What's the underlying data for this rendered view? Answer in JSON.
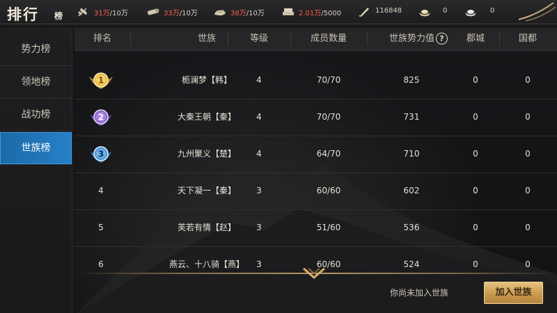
{
  "header": {
    "title_main": "排行",
    "title_sub": "榜",
    "resources": [
      {
        "icon": "grain-icon",
        "current": "31万",
        "max": "/10万",
        "current_color": "#ff5a4a"
      },
      {
        "icon": "wood-icon",
        "current": "33万",
        "max": "/10万",
        "current_color": "#ff5a4a"
      },
      {
        "icon": "stone-icon",
        "current": "38万",
        "max": "/10万",
        "current_color": "#ff5a4a"
      },
      {
        "icon": "iron-icon",
        "current": "2.01万",
        "max": "/5000",
        "current_color": "#ff5a4a"
      },
      {
        "icon": "decree-icon",
        "current": "116848",
        "max": ""
      },
      {
        "icon": "gold-ingot-icon",
        "current": "0",
        "max": ""
      },
      {
        "icon": "silver-ingot-icon",
        "current": "0",
        "max": ""
      }
    ]
  },
  "sidebar": {
    "items": [
      {
        "label": "势力榜",
        "active": false
      },
      {
        "label": "领地榜",
        "active": false
      },
      {
        "label": "战功榜",
        "active": false
      },
      {
        "label": "世族榜",
        "active": true
      }
    ],
    "active_color": "#2580c7"
  },
  "table": {
    "headers": {
      "rank": "排名",
      "clan": "世族",
      "level": "等级",
      "members": "成员数量",
      "power": "世族势力值",
      "help": "?",
      "cities": "郡城",
      "capitals": "国都"
    },
    "rows": [
      {
        "rank": "1",
        "medal": "gold-medal-icon",
        "clan": "栀澜梦【韩】",
        "level": "4",
        "members": "70/70",
        "power": "825",
        "cities": "0",
        "capitals": "0"
      },
      {
        "rank": "2",
        "medal": "purple-medal-icon",
        "clan": "大秦王朝【秦】",
        "level": "4",
        "members": "70/70",
        "power": "731",
        "cities": "0",
        "capitals": "0"
      },
      {
        "rank": "3",
        "medal": "blue-medal-icon",
        "clan": "九州聚义【楚】",
        "level": "4",
        "members": "64/70",
        "power": "710",
        "cities": "0",
        "capitals": "0"
      },
      {
        "rank": "4",
        "medal": "",
        "clan": "天下凝一【秦】",
        "level": "3",
        "members": "60/60",
        "power": "602",
        "cities": "0",
        "capitals": "0"
      },
      {
        "rank": "5",
        "medal": "",
        "clan": "芙若有情【赵】",
        "level": "3",
        "members": "51/60",
        "power": "536",
        "cities": "0",
        "capitals": "0"
      },
      {
        "rank": "6",
        "medal": "",
        "clan": "燕云、十八骑【燕】",
        "level": "3",
        "members": "60/60",
        "power": "524",
        "cities": "0",
        "capitals": "0"
      }
    ]
  },
  "footer": {
    "notice": "你尚未加入世族",
    "join_label": "加入世族",
    "scroll_icon": "chevron-down-icon",
    "button_color": "#c99a4f"
  }
}
